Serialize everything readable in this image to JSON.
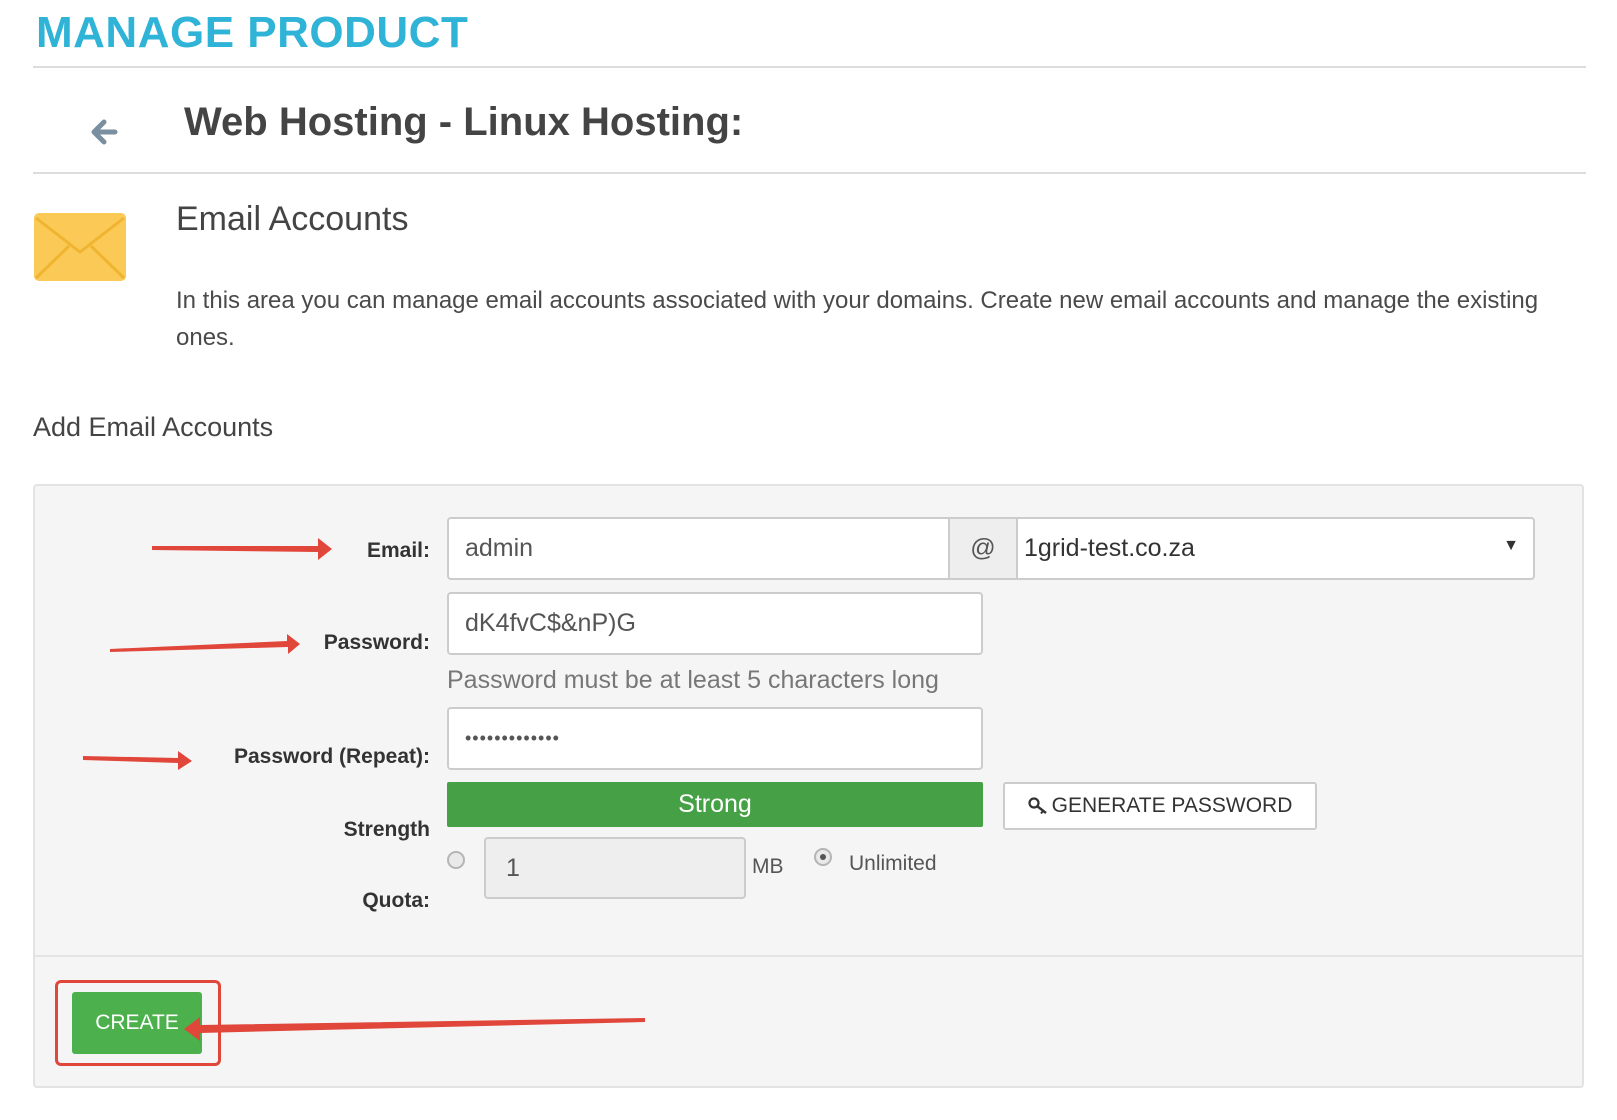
{
  "header": {
    "page_title": "MANAGE PRODUCT",
    "product_title": "Web Hosting - Linux Hosting:"
  },
  "section": {
    "title": "Email Accounts",
    "description": "In this area you can manage email accounts associated with your domains. Create new email accounts and manage the existing ones."
  },
  "form": {
    "heading": "Add Email Accounts",
    "email_label": "Email:",
    "email_value": "admin",
    "at_symbol": "@",
    "domain_value": "1grid-test.co.za",
    "password_label": "Password:",
    "password_value": "dK4fvC$&nP)G",
    "password_help": "Password must be at least 5 characters long",
    "password_repeat_label": "Password (Repeat):",
    "password_repeat_value": "•••••••••••••",
    "strength_label": "Strength",
    "strength_value": "Strong",
    "generate_button": "GENERATE PASSWORD",
    "quota_label": "Quota:",
    "quota_value": "1",
    "quota_unit": "MB",
    "unlimited_label": "Unlimited",
    "quota_mode": "Unlimited",
    "create_button": "CREATE"
  },
  "colors": {
    "title_accent": "#2fb3d6",
    "strength_bar": "#46a046",
    "create_button": "#4cb14c",
    "annotation": "#e0463a",
    "envelope": "#fbc955"
  },
  "icons": {
    "back": "arrow-left-icon",
    "section": "envelope-icon",
    "generate": "key-icon",
    "dropdown": "caret-down-icon"
  }
}
